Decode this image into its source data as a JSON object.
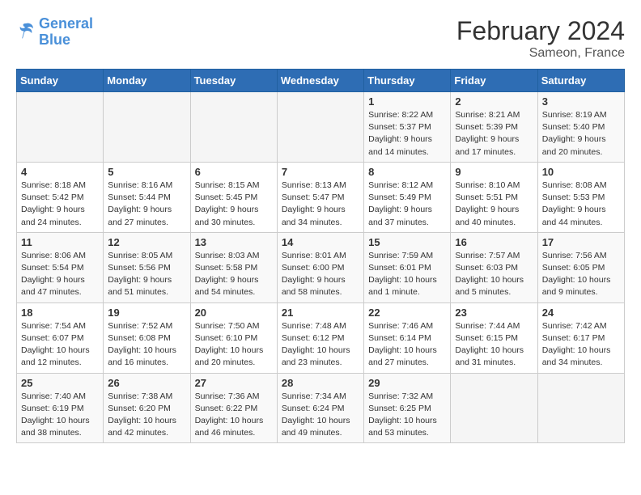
{
  "header": {
    "logo_line1": "General",
    "logo_line2": "Blue",
    "month": "February 2024",
    "location": "Sameon, France"
  },
  "weekdays": [
    "Sunday",
    "Monday",
    "Tuesday",
    "Wednesday",
    "Thursday",
    "Friday",
    "Saturday"
  ],
  "weeks": [
    [
      {
        "day": "",
        "info": ""
      },
      {
        "day": "",
        "info": ""
      },
      {
        "day": "",
        "info": ""
      },
      {
        "day": "",
        "info": ""
      },
      {
        "day": "1",
        "info": "Sunrise: 8:22 AM\nSunset: 5:37 PM\nDaylight: 9 hours\nand 14 minutes."
      },
      {
        "day": "2",
        "info": "Sunrise: 8:21 AM\nSunset: 5:39 PM\nDaylight: 9 hours\nand 17 minutes."
      },
      {
        "day": "3",
        "info": "Sunrise: 8:19 AM\nSunset: 5:40 PM\nDaylight: 9 hours\nand 20 minutes."
      }
    ],
    [
      {
        "day": "4",
        "info": "Sunrise: 8:18 AM\nSunset: 5:42 PM\nDaylight: 9 hours\nand 24 minutes."
      },
      {
        "day": "5",
        "info": "Sunrise: 8:16 AM\nSunset: 5:44 PM\nDaylight: 9 hours\nand 27 minutes."
      },
      {
        "day": "6",
        "info": "Sunrise: 8:15 AM\nSunset: 5:45 PM\nDaylight: 9 hours\nand 30 minutes."
      },
      {
        "day": "7",
        "info": "Sunrise: 8:13 AM\nSunset: 5:47 PM\nDaylight: 9 hours\nand 34 minutes."
      },
      {
        "day": "8",
        "info": "Sunrise: 8:12 AM\nSunset: 5:49 PM\nDaylight: 9 hours\nand 37 minutes."
      },
      {
        "day": "9",
        "info": "Sunrise: 8:10 AM\nSunset: 5:51 PM\nDaylight: 9 hours\nand 40 minutes."
      },
      {
        "day": "10",
        "info": "Sunrise: 8:08 AM\nSunset: 5:53 PM\nDaylight: 9 hours\nand 44 minutes."
      }
    ],
    [
      {
        "day": "11",
        "info": "Sunrise: 8:06 AM\nSunset: 5:54 PM\nDaylight: 9 hours\nand 47 minutes."
      },
      {
        "day": "12",
        "info": "Sunrise: 8:05 AM\nSunset: 5:56 PM\nDaylight: 9 hours\nand 51 minutes."
      },
      {
        "day": "13",
        "info": "Sunrise: 8:03 AM\nSunset: 5:58 PM\nDaylight: 9 hours\nand 54 minutes."
      },
      {
        "day": "14",
        "info": "Sunrise: 8:01 AM\nSunset: 6:00 PM\nDaylight: 9 hours\nand 58 minutes."
      },
      {
        "day": "15",
        "info": "Sunrise: 7:59 AM\nSunset: 6:01 PM\nDaylight: 10 hours\nand 1 minute."
      },
      {
        "day": "16",
        "info": "Sunrise: 7:57 AM\nSunset: 6:03 PM\nDaylight: 10 hours\nand 5 minutes."
      },
      {
        "day": "17",
        "info": "Sunrise: 7:56 AM\nSunset: 6:05 PM\nDaylight: 10 hours\nand 9 minutes."
      }
    ],
    [
      {
        "day": "18",
        "info": "Sunrise: 7:54 AM\nSunset: 6:07 PM\nDaylight: 10 hours\nand 12 minutes."
      },
      {
        "day": "19",
        "info": "Sunrise: 7:52 AM\nSunset: 6:08 PM\nDaylight: 10 hours\nand 16 minutes."
      },
      {
        "day": "20",
        "info": "Sunrise: 7:50 AM\nSunset: 6:10 PM\nDaylight: 10 hours\nand 20 minutes."
      },
      {
        "day": "21",
        "info": "Sunrise: 7:48 AM\nSunset: 6:12 PM\nDaylight: 10 hours\nand 23 minutes."
      },
      {
        "day": "22",
        "info": "Sunrise: 7:46 AM\nSunset: 6:14 PM\nDaylight: 10 hours\nand 27 minutes."
      },
      {
        "day": "23",
        "info": "Sunrise: 7:44 AM\nSunset: 6:15 PM\nDaylight: 10 hours\nand 31 minutes."
      },
      {
        "day": "24",
        "info": "Sunrise: 7:42 AM\nSunset: 6:17 PM\nDaylight: 10 hours\nand 34 minutes."
      }
    ],
    [
      {
        "day": "25",
        "info": "Sunrise: 7:40 AM\nSunset: 6:19 PM\nDaylight: 10 hours\nand 38 minutes."
      },
      {
        "day": "26",
        "info": "Sunrise: 7:38 AM\nSunset: 6:20 PM\nDaylight: 10 hours\nand 42 minutes."
      },
      {
        "day": "27",
        "info": "Sunrise: 7:36 AM\nSunset: 6:22 PM\nDaylight: 10 hours\nand 46 minutes."
      },
      {
        "day": "28",
        "info": "Sunrise: 7:34 AM\nSunset: 6:24 PM\nDaylight: 10 hours\nand 49 minutes."
      },
      {
        "day": "29",
        "info": "Sunrise: 7:32 AM\nSunset: 6:25 PM\nDaylight: 10 hours\nand 53 minutes."
      },
      {
        "day": "",
        "info": ""
      },
      {
        "day": "",
        "info": ""
      }
    ]
  ]
}
